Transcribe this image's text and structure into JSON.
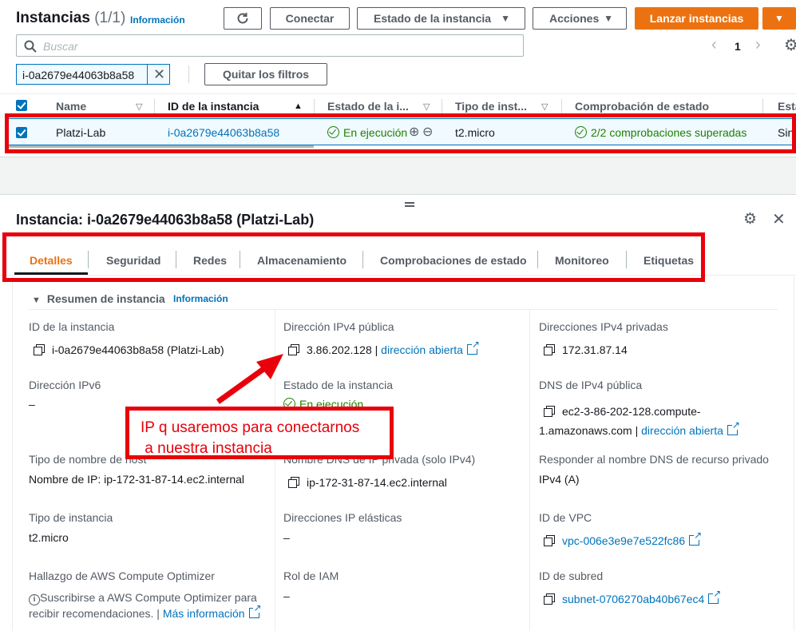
{
  "header": {
    "title": "Instancias",
    "count": "(1/1)",
    "info_link": "Información",
    "connect": "Conectar",
    "instance_state": "Estado de la instancia",
    "actions": "Acciones",
    "launch": "Lanzar instancias"
  },
  "search": {
    "placeholder": "Buscar"
  },
  "pagination": {
    "page": "1"
  },
  "filter": {
    "token": "i-0a2679e44063b8a58",
    "clear": "Quitar los filtros"
  },
  "table": {
    "columns": [
      "Name",
      "ID de la instancia",
      "Estado de la i...",
      "Tipo de inst...",
      "Comprobación de estado",
      "Esta"
    ],
    "row": {
      "name": "Platzi-Lab",
      "id": "i-0a2679e44063b8a58",
      "state": "En ejecución",
      "type": "t2.micro",
      "checks": "2/2 comprobaciones superadas",
      "alarm": "Sin"
    }
  },
  "detail": {
    "title": "Instancia: i-0a2679e44063b8a58 (Platzi-Lab)",
    "tabs": [
      "Detalles",
      "Seguridad",
      "Redes",
      "Almacenamiento",
      "Comprobaciones de estado",
      "Monitoreo",
      "Etiquetas"
    ],
    "summary_title": "Resumen de instancia",
    "summary_info": "Información",
    "col1": {
      "id_label": "ID de la instancia",
      "id_value": "i-0a2679e44063b8a58 (Platzi-Lab)",
      "ipv6_label": "Dirección IPv6",
      "ipv6_value": "–",
      "hostname_label": "Tipo de nombre de host",
      "hostname_value": "Nombre de IP: ip-172-31-87-14.ec2.internal",
      "itype_label": "Tipo de instancia",
      "itype_value": "t2.micro",
      "optimizer_label": "Hallazgo de AWS Compute Optimizer",
      "optimizer_text1": "Suscribirse a AWS Compute Optimizer para",
      "optimizer_text2": "recibir recomendaciones.",
      "optimizer_link": "Más información"
    },
    "col2": {
      "ipv4_label": "Dirección IPv4 pública",
      "ipv4_value": "3.86.202.128",
      "ipv4_link": "dirección abierta",
      "state_label": "Estado de la instancia",
      "state_value": "En ejecución",
      "privdns_label": "Nombre DNS de IP privada (solo IPv4)",
      "privdns_value": "ip-172-31-87-14.ec2.internal",
      "eip_label": "Direcciones IP elásticas",
      "eip_value": "–",
      "iam_label": "Rol de IAM",
      "iam_value": "–"
    },
    "col3": {
      "priv_label": "Direcciones IPv4 privadas",
      "priv_value": "172.31.87.14",
      "pubdns_label": "DNS de IPv4 pública",
      "pubdns_value1": "ec2-3-86-202-128.compute-",
      "pubdns_value2": "1.amazonaws.com |",
      "pubdns_link": "dirección abierta",
      "resp_label": "Responder al nombre DNS de recurso privado",
      "resp_value": "IPv4 (A)",
      "vpc_label": "ID de VPC",
      "vpc_value": "vpc-006e3e9e7e522fc86",
      "subnet_label": "ID de subred",
      "subnet_value": "subnet-0706270ab40b67ec4"
    }
  },
  "annotation": {
    "line1": "IP q usaremos para conectarnos",
    "line2": " a nuestra instancia",
    "color": "#e8000b"
  }
}
